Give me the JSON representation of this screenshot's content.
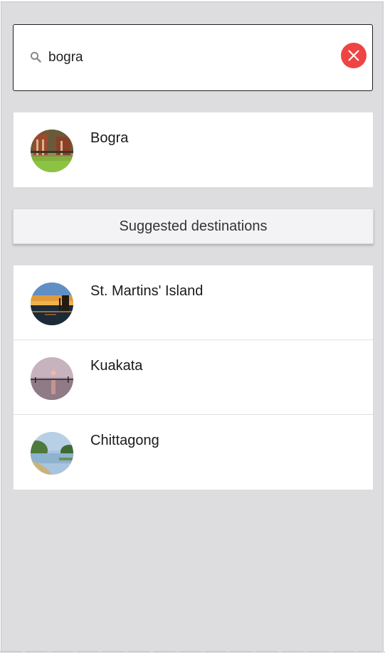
{
  "search": {
    "query": "bogra"
  },
  "results": [
    {
      "label": "Bogra",
      "thumb": "bogra"
    }
  ],
  "suggested": {
    "header": "Suggested destinations",
    "items": [
      {
        "label": "St. Martins' Island",
        "thumb": "island"
      },
      {
        "label": "Kuakata",
        "thumb": "kuakata"
      },
      {
        "label": "Chittagong",
        "thumb": "chittagong"
      }
    ]
  },
  "colors": {
    "background": "#dddcdf",
    "clear_button": "#ee4444",
    "card": "#ffffff"
  }
}
